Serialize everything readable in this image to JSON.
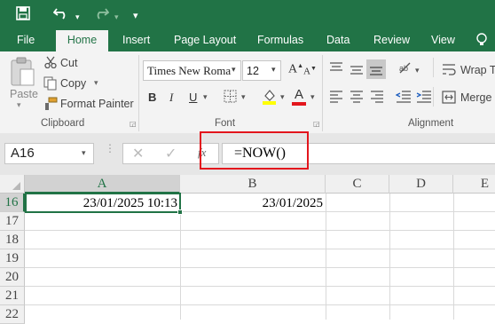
{
  "ribbon_tabs": [
    "File",
    "Home",
    "Insert",
    "Page Layout",
    "Formulas",
    "Data",
    "Review",
    "View"
  ],
  "clipboard": {
    "paste": "Paste",
    "cut": "Cut",
    "copy": "Copy",
    "format_painter": "Format Painter",
    "group": "Clipboard"
  },
  "font": {
    "name": "Times New Roma",
    "size": "12",
    "bold": "B",
    "italic": "I",
    "underline": "U",
    "font_color_glyph": "A",
    "group": "Font"
  },
  "alignment": {
    "wrap_text": "Wrap Te",
    "merge": "Merge &",
    "group": "Alignment"
  },
  "formula_bar": {
    "name_box": "A16",
    "formula": "=NOW()",
    "fx": "fx"
  },
  "columns": [
    "A",
    "B",
    "C",
    "D",
    "E"
  ],
  "rows": [
    "16",
    "17",
    "18",
    "19",
    "20",
    "21",
    "22"
  ],
  "cells": {
    "A16": "23/01/2025 10:13",
    "B16": "23/01/2025"
  },
  "colors": {
    "excel_green": "#217346",
    "highlight_red": "#e3161d"
  }
}
